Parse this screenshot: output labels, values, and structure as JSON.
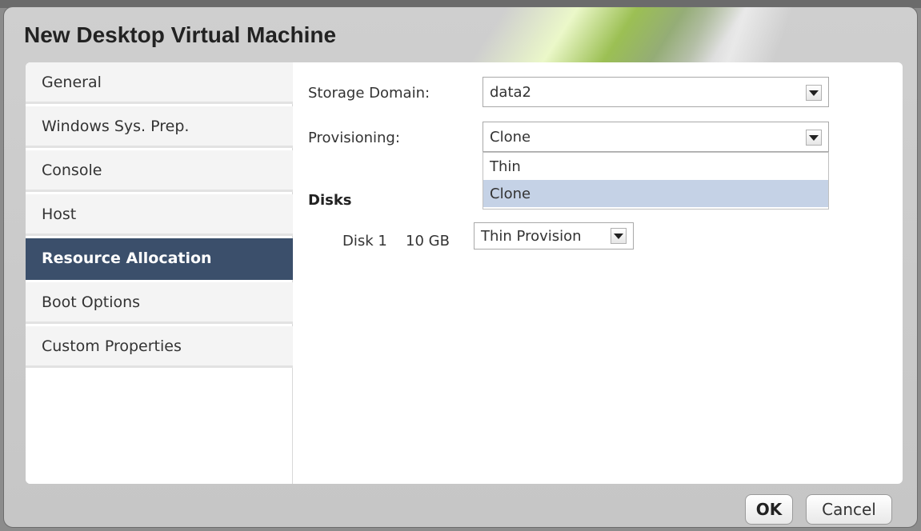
{
  "dialog": {
    "title": "New Desktop Virtual Machine"
  },
  "nav": {
    "items": [
      {
        "label": "General"
      },
      {
        "label": "Windows Sys. Prep."
      },
      {
        "label": "Console"
      },
      {
        "label": "Host"
      },
      {
        "label": "Resource Allocation",
        "active": true
      },
      {
        "label": "Boot Options"
      },
      {
        "label": "Custom Properties"
      }
    ]
  },
  "form": {
    "storage_domain": {
      "label": "Storage Domain:",
      "value": "data2"
    },
    "provisioning": {
      "label": "Provisioning:",
      "value": "Clone",
      "options": [
        "Thin",
        "Clone"
      ],
      "highlighted": "Clone"
    },
    "disks": {
      "title": "Disks",
      "rows": [
        {
          "name": "Disk 1",
          "size": "10 GB",
          "allocation": "Thin Provision"
        }
      ]
    }
  },
  "buttons": {
    "ok": "OK",
    "cancel": "Cancel"
  },
  "colors": {
    "active_nav": "#3b4f6b",
    "selected_option": "#c5d2e6"
  }
}
